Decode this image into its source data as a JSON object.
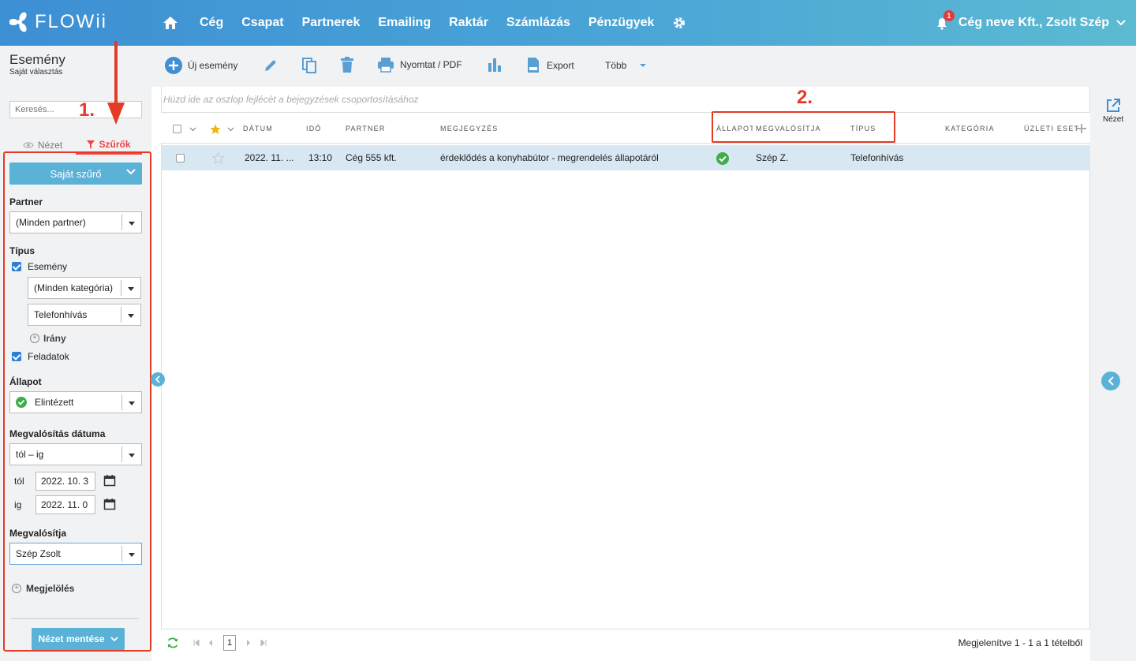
{
  "app": {
    "logo_text": "FLOWii",
    "nav": [
      "Cég",
      "Csapat",
      "Partnerek",
      "Emailing",
      "Raktár",
      "Számlázás",
      "Pénzügyek"
    ],
    "notification_count": "1",
    "account_label": "Cég neve Kft., Zsolt Szép"
  },
  "page": {
    "title": "Esemény",
    "subtitle": "Saját választás"
  },
  "left": {
    "search_placeholder": "Keresés...",
    "tab_view": "Nézet",
    "tab_filters": "Szűrők",
    "own_filter": "Saját szűrő",
    "partner_label": "Partner",
    "partner_value": "(Minden partner)",
    "type_label": "Típus",
    "event_check": "Esemény",
    "category_value": "(Minden kategória)",
    "subtype_value": "Telefonhívás",
    "direction_label": "Irány",
    "tasks_check": "Feladatok",
    "status_label": "Állapot",
    "status_value": "Elintézett",
    "date_label": "Megvalósítás dátuma",
    "date_mode": "tól – ig",
    "from_label": "tól",
    "from_value": "2022. 10. 3",
    "to_label": "ig",
    "to_value": "2022. 11. 0",
    "owner_label": "Megvalósítja",
    "owner_value": "Szép Zsolt",
    "marking_label": "Megjelölés",
    "save_view": "Nézet mentése"
  },
  "toolbar": {
    "new_event": "Új esemény",
    "print": "Nyomtat / PDF",
    "export": "Export",
    "more": "Több"
  },
  "grid": {
    "group_hint": "Húzd ide az oszlop fejlécét a bejegyzések csoportosításához",
    "headers": {
      "date": "DÁTUM",
      "time": "IDŐ",
      "partner": "PARTNER",
      "note": "MEGJEGYZÉS",
      "status": "ÁLLAPOT",
      "owner": "MEGVALÓSÍTJA",
      "type": "TÍPUS",
      "category": "KATEGÓRIA",
      "business_case": "ÜZLETI ESET"
    },
    "rows": [
      {
        "date": "2022. 11. ...",
        "time": "13:10",
        "partner": "Cég 555 kft.",
        "note": "érdeklődés a konyhabútor - megrendelés állapotáról",
        "status": "done",
        "owner": "Szép Z.",
        "type": "Telefonhívás",
        "category": "",
        "business_case": ""
      }
    ],
    "page": "1",
    "footer_info": "Megjelenítve 1 - 1 a 1 tételből"
  },
  "right": {
    "view_label": "Nézet"
  },
  "annotations": {
    "step1": "1.",
    "step2": "2."
  },
  "colors": {
    "accent": "#5ab2d6",
    "annotation": "#e53a25",
    "selected_row": "#d8e8f3",
    "done_green": "#3fae49"
  }
}
